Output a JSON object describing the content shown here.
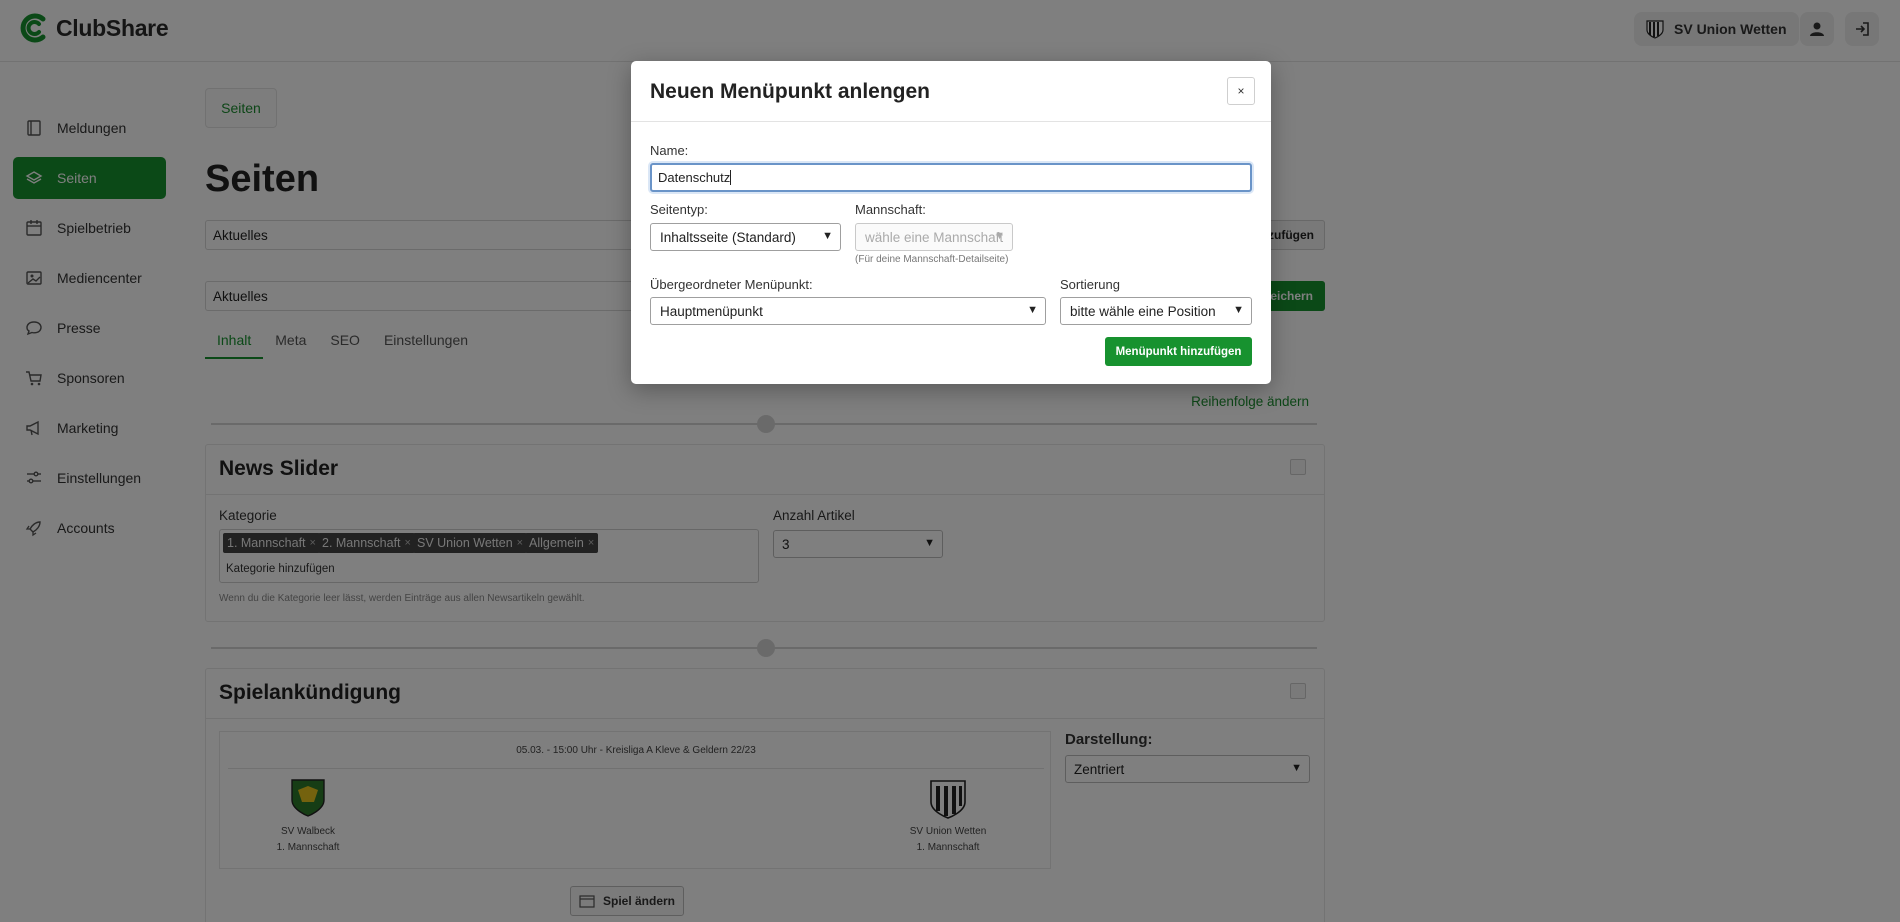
{
  "app": {
    "name": "ClubShare"
  },
  "header": {
    "club_name": "SV Union Wetten"
  },
  "sidebar": {
    "items": [
      {
        "label": "Meldungen",
        "icon": "book-icon"
      },
      {
        "label": "Seiten",
        "icon": "layers-icon",
        "active": true
      },
      {
        "label": "Spielbetrieb",
        "icon": "calendar-icon"
      },
      {
        "label": "Mediencenter",
        "icon": "image-icon"
      },
      {
        "label": "Presse",
        "icon": "chat-bubble-icon"
      },
      {
        "label": "Sponsoren",
        "icon": "cart-icon"
      },
      {
        "label": "Marketing",
        "icon": "megaphone-icon"
      },
      {
        "label": "Einstellungen",
        "icon": "sliders-icon"
      },
      {
        "label": "Accounts",
        "icon": "rocket-icon"
      }
    ]
  },
  "main": {
    "breadcrumb": "Seiten",
    "title": "Seiten",
    "page_select": "Aktuelles",
    "add_button_fragment": "zufügen",
    "page_name_value": "Aktuelles",
    "save_button_fragment": "eichern",
    "tabs": [
      "Inhalt",
      "Meta",
      "SEO",
      "Einstellungen"
    ],
    "reorder_link": "Reihenfolge ändern",
    "news_slider": {
      "title": "News Slider",
      "category_label": "Kategorie",
      "tags": [
        "1. Mannschaft",
        "2. Mannschaft",
        "SV Union Wetten",
        "Allgemein"
      ],
      "tag_placeholder": "Kategorie hinzufügen",
      "hint": "Wenn du die Kategorie leer lässt, werden Einträge aus allen Newsartikeln gewählt.",
      "count_label": "Anzahl Artikel",
      "count_value": "3"
    },
    "match": {
      "title": "Spielankündigung",
      "info": "05.03. - 15:00 Uhr  -  Kreisliga A Kleve & Geldern 22/23",
      "home_team": "SV Walbeck",
      "home_squad": "1. Mannschaft",
      "away_team": "SV Union Wetten",
      "away_squad": "1. Mannschaft",
      "change_button": "Spiel ändern",
      "display_label": "Darstellung:",
      "display_value": "Zentriert"
    }
  },
  "modal": {
    "title": "Neuen Menüpunkt anlengen",
    "close_label": "×",
    "name_label": "Name:",
    "name_value": "Datenschutz",
    "type_label": "Seitentyp:",
    "type_value": "Inhaltsseite (Standard)",
    "team_label": "Mannschaft:",
    "team_placeholder": "wähle eine Mannschaft",
    "team_hint": "(Für deine Mannschaft-Detailseite)",
    "parent_label": "Übergeordneter Menüpunkt:",
    "parent_value": "Hauptmenüpunkt",
    "sort_label": "Sortierung",
    "sort_value": "bitte wähle eine Position",
    "submit_label": "Menüpunkt hinzufügen"
  },
  "colors": {
    "accent": "#17922f",
    "overlay": "rgba(0,0,0,0.5)"
  }
}
